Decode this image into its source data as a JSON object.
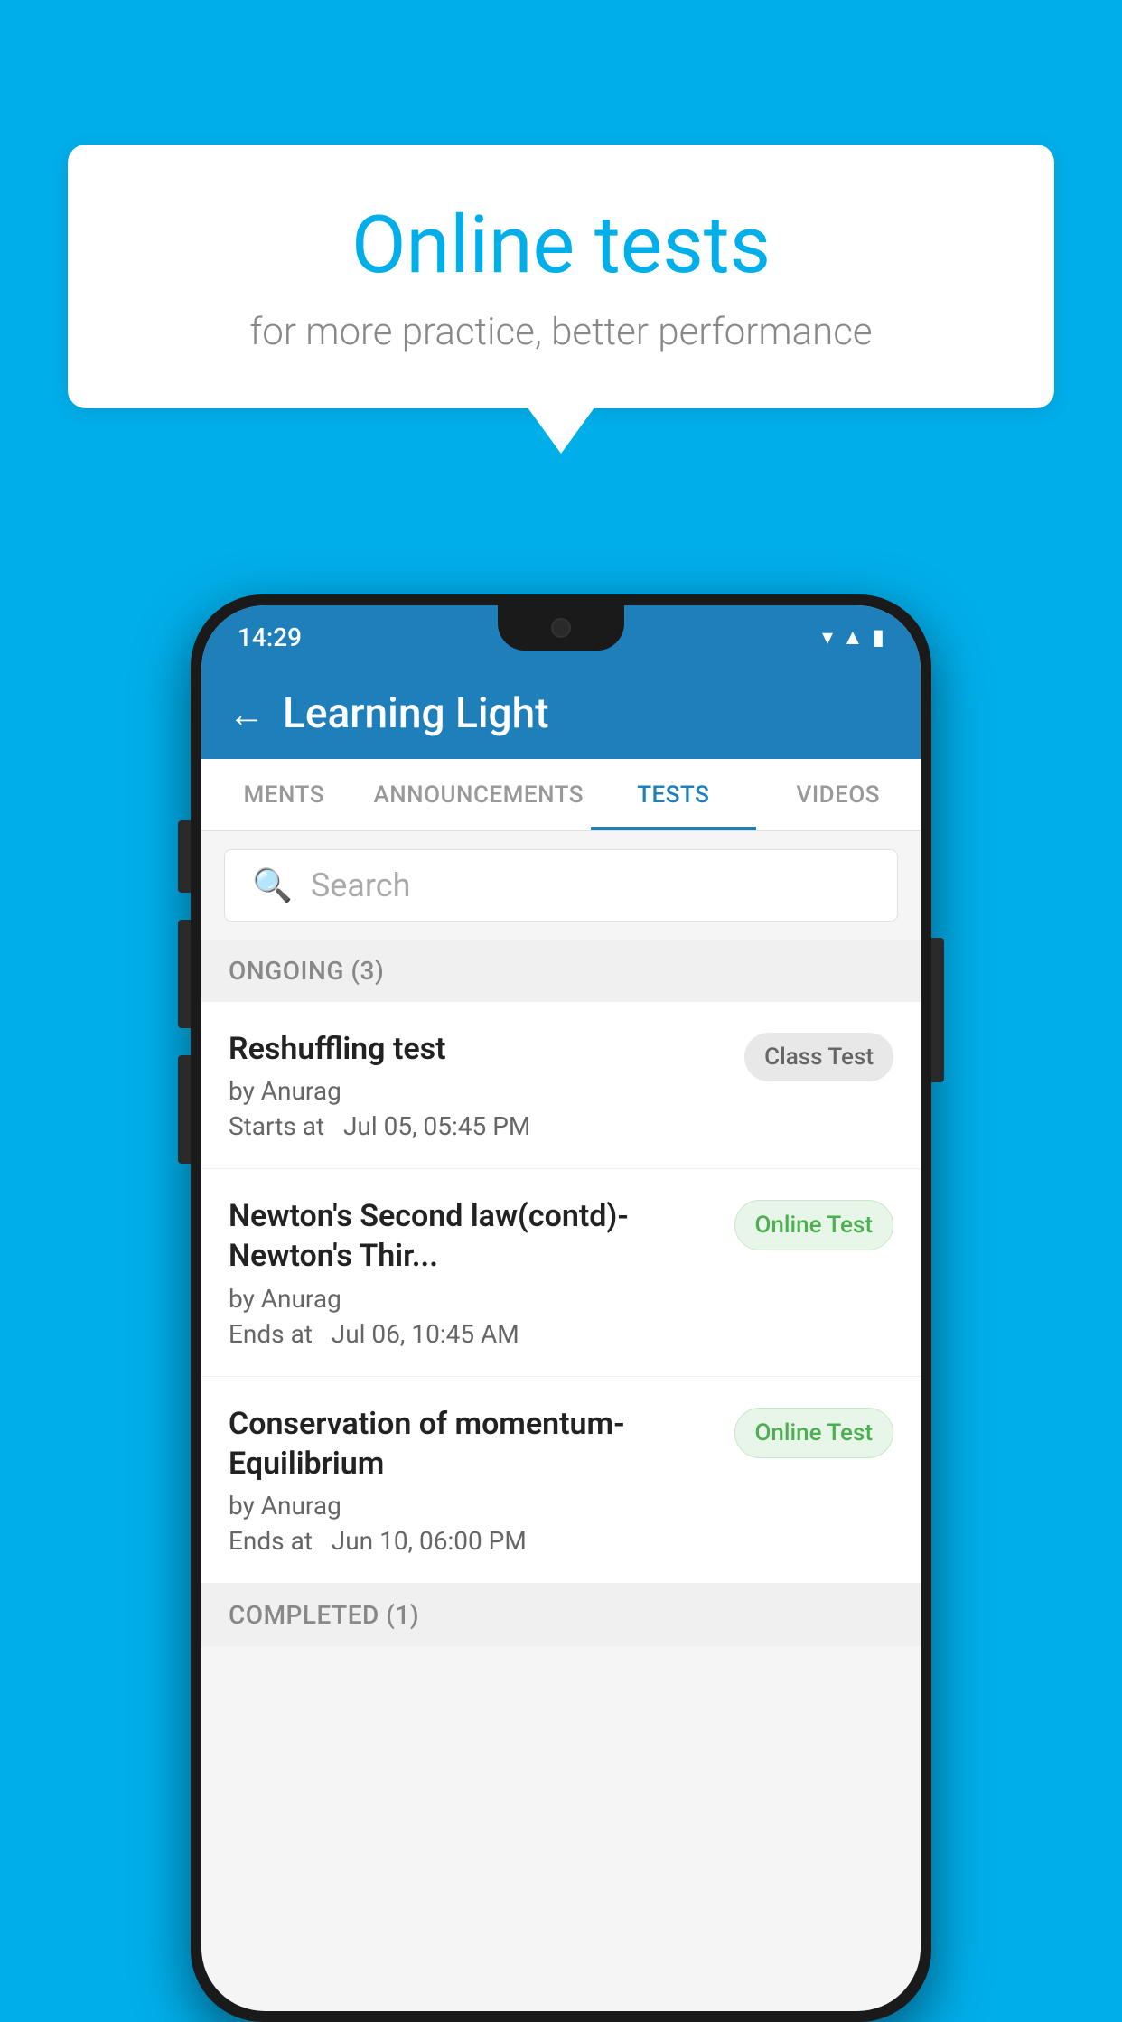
{
  "background_color": "#00AEEA",
  "speech_bubble": {
    "title": "Online tests",
    "subtitle": "for more practice, better performance"
  },
  "phone": {
    "status_bar": {
      "time": "14:29",
      "icons": [
        "wifi",
        "signal",
        "battery"
      ]
    },
    "header": {
      "back_label": "←",
      "title": "Learning Light"
    },
    "tabs": [
      {
        "label": "MENTS",
        "active": false
      },
      {
        "label": "ANNOUNCEMENTS",
        "active": false
      },
      {
        "label": "TESTS",
        "active": true
      },
      {
        "label": "VIDEOS",
        "active": false
      }
    ],
    "search": {
      "placeholder": "Search"
    },
    "sections": [
      {
        "title": "ONGOING (3)",
        "tests": [
          {
            "name": "Reshuffling test",
            "author": "by Anurag",
            "time_label": "Starts at",
            "time": "Jul 05, 05:45 PM",
            "badge": "Class Test",
            "badge_type": "class"
          },
          {
            "name": "Newton's Second law(contd)-Newton's Thir...",
            "author": "by Anurag",
            "time_label": "Ends at",
            "time": "Jul 06, 10:45 AM",
            "badge": "Online Test",
            "badge_type": "online"
          },
          {
            "name": "Conservation of momentum-Equilibrium",
            "author": "by Anurag",
            "time_label": "Ends at",
            "time": "Jun 10, 06:00 PM",
            "badge": "Online Test",
            "badge_type": "online"
          }
        ]
      },
      {
        "title": "COMPLETED (1)",
        "tests": []
      }
    ]
  }
}
